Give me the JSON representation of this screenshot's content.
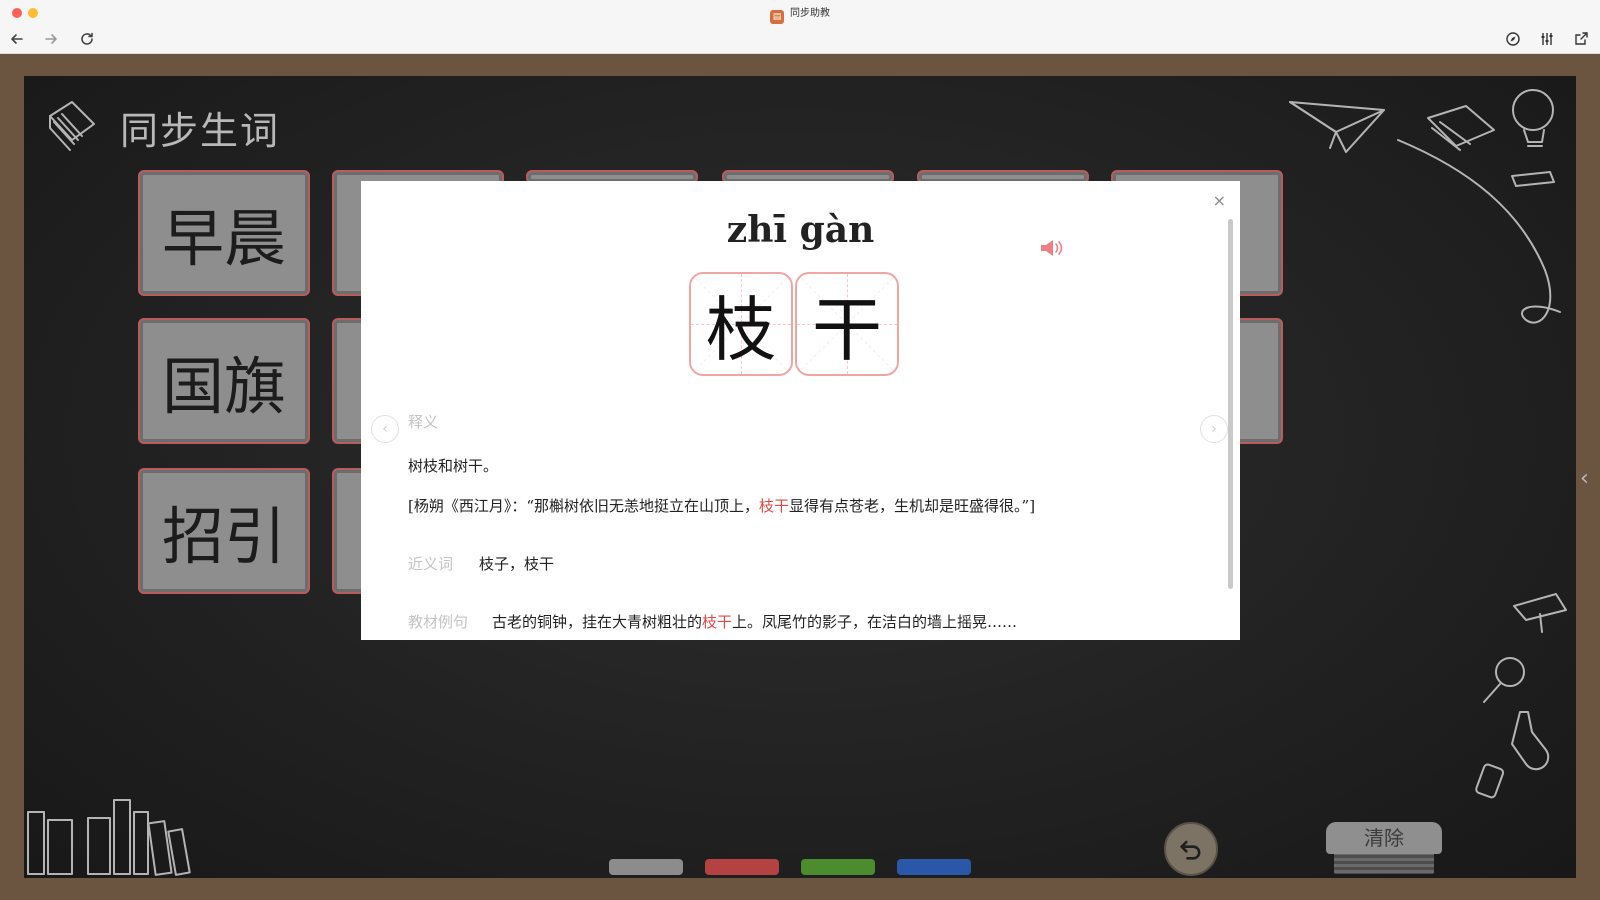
{
  "window": {
    "title": "同步助教"
  },
  "board": {
    "title": "同步生词",
    "cards_visible": [
      {
        "text": "早晨"
      },
      {
        "text": "国旗"
      },
      {
        "text": "招引"
      }
    ]
  },
  "modal": {
    "pinyin": "zhī gàn",
    "characters": [
      "枝",
      "干"
    ],
    "close_symbol": "×",
    "definition_label": "释义",
    "definition_text": "树枝和树干。",
    "example_prefix": "[杨朔《西江月》：“那槲树依旧无恙地挺立在山顶上，",
    "example_highlight": "枝干",
    "example_suffix": "显得有点苍老，生机却是旺盛得很。”]",
    "synonym_label": "近义词",
    "synonym_text": "枝子，枝干",
    "textbook_label": "教材例句",
    "textbook_prefix": "古老的铜钟，挂在大青树粗壮的",
    "textbook_highlight": "枝干",
    "textbook_suffix": "上。凤尾竹的影子，在洁白的墙上摇晃……",
    "prev_arrow": "‹",
    "next_arrow": "›"
  },
  "controls": {
    "chalk_colors": [
      "#8c8c8c",
      "#b54242",
      "#4c8c2f",
      "#2a57a8"
    ],
    "clear_label": "清除",
    "side_toggle": "‹"
  },
  "colors": {
    "frame": "#6b5440",
    "board": "#222222",
    "highlight": "#e04848",
    "char_border": "#f0a5a5"
  }
}
